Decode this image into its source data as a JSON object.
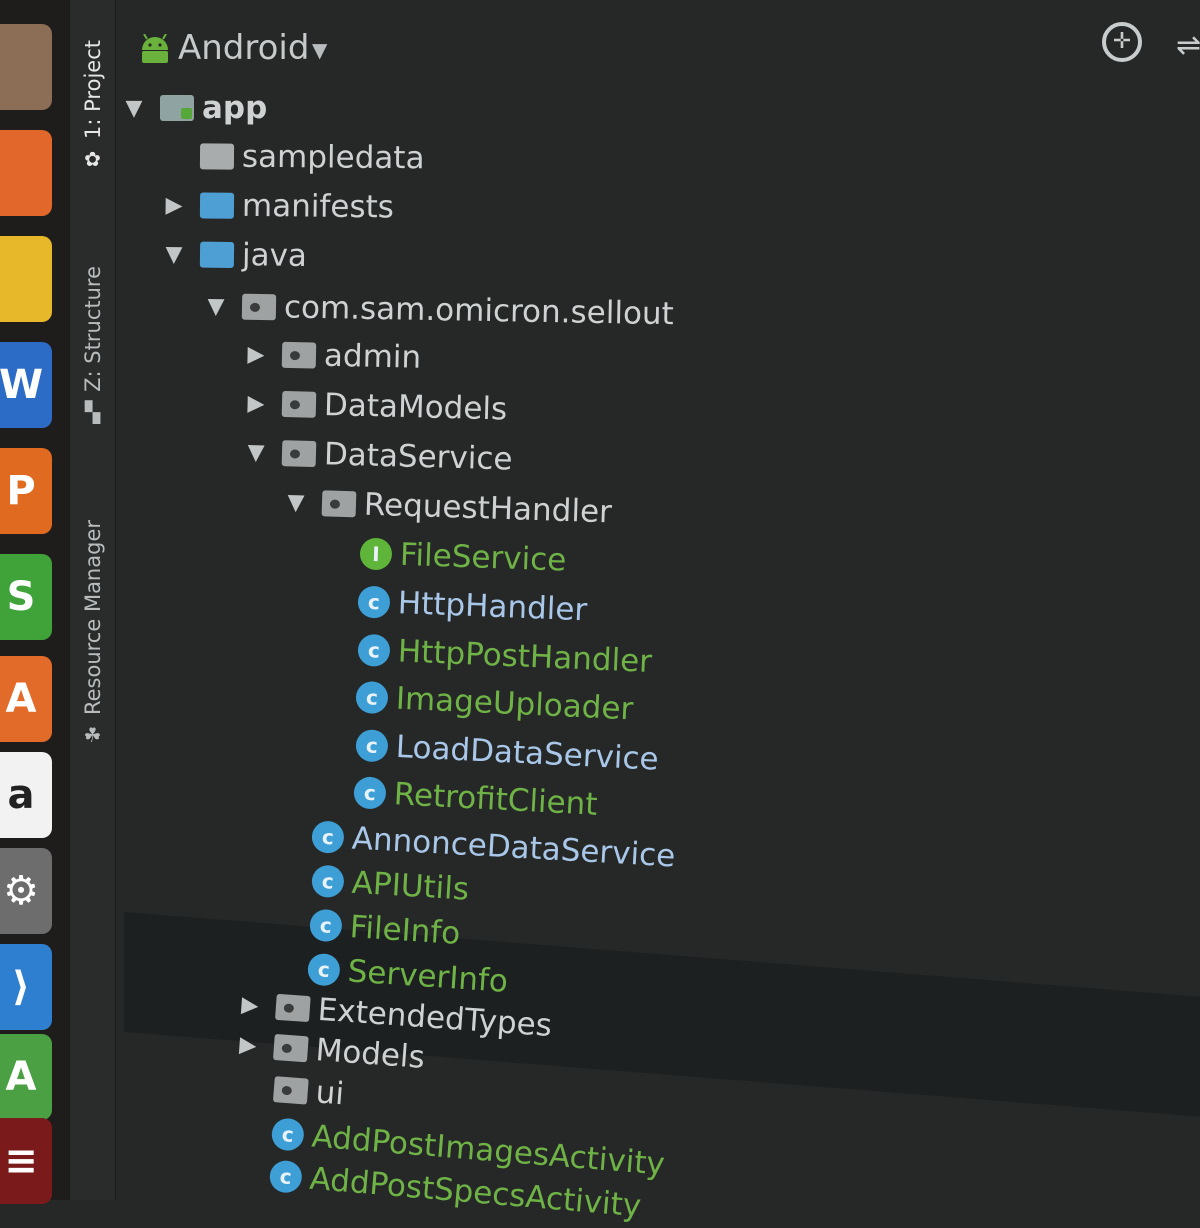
{
  "dock": {
    "icons": [
      {
        "name": "files-icon",
        "glyph": "",
        "color": "#8c6d55"
      },
      {
        "name": "firefox-icon",
        "glyph": "",
        "color": "#e2672b"
      },
      {
        "name": "chrome-icon",
        "glyph": "",
        "color": "#e6b82a"
      },
      {
        "name": "writer-icon",
        "glyph": "W",
        "color": "#2d6cc6"
      },
      {
        "name": "impress-icon",
        "glyph": "P",
        "color": "#e06a1f"
      },
      {
        "name": "calc-icon",
        "glyph": "S",
        "color": "#3fa33a"
      },
      {
        "name": "software-center-icon",
        "glyph": "A",
        "color": "#e36b2a"
      },
      {
        "name": "amazon-icon",
        "glyph": "a",
        "color": "#f2f2f2"
      },
      {
        "name": "system-settings-icon",
        "glyph": "⚙",
        "color": "#6d6d6d"
      },
      {
        "name": "vscode-icon",
        "glyph": "⟩",
        "color": "#2f7fd0"
      },
      {
        "name": "android-studio-icon",
        "glyph": "A",
        "color": "#4aa043"
      },
      {
        "name": "terminal-icon",
        "glyph": "≡",
        "color": "#7a1a1a"
      }
    ]
  },
  "tool_stripe": {
    "project": "1: Project",
    "structure": "Z: Structure",
    "resource_manager": "Resource Manager"
  },
  "panel": {
    "view_selector": "Android",
    "tree": [
      {
        "label": "app",
        "arrow": "down",
        "icon": "module",
        "color": "normal",
        "bold": true
      },
      {
        "label": "sampledata",
        "arrow": "none",
        "icon": "folder-grey",
        "color": "normal"
      },
      {
        "label": "manifests",
        "arrow": "right",
        "icon": "folder-blue",
        "color": "normal"
      },
      {
        "label": "java",
        "arrow": "down",
        "icon": "folder-blue",
        "color": "normal"
      },
      {
        "label": "com.sam.omicron.sellout",
        "arrow": "down",
        "icon": "package",
        "color": "normal"
      },
      {
        "label": "admin",
        "arrow": "right",
        "icon": "package",
        "color": "normal"
      },
      {
        "label": "DataModels",
        "arrow": "right",
        "icon": "package",
        "color": "normal"
      },
      {
        "label": "DataService",
        "arrow": "down",
        "icon": "package",
        "color": "normal"
      },
      {
        "label": "RequestHandler",
        "arrow": "down",
        "icon": "package",
        "color": "normal"
      },
      {
        "label": "FileService",
        "arrow": "none",
        "icon": "interface",
        "color": "green"
      },
      {
        "label": "HttpHandler",
        "arrow": "none",
        "icon": "class",
        "color": "blue"
      },
      {
        "label": "HttpPostHandler",
        "arrow": "none",
        "icon": "class",
        "color": "green"
      },
      {
        "label": "ImageUploader",
        "arrow": "none",
        "icon": "class",
        "color": "green"
      },
      {
        "label": "LoadDataService",
        "arrow": "none",
        "icon": "class",
        "color": "blue"
      },
      {
        "label": "RetrofitClient",
        "arrow": "none",
        "icon": "class",
        "color": "green"
      },
      {
        "label": "AnnonceDataService",
        "arrow": "none",
        "icon": "class",
        "color": "blue"
      },
      {
        "label": "APIUtils",
        "arrow": "none",
        "icon": "class",
        "color": "green"
      },
      {
        "label": "FileInfo",
        "arrow": "none",
        "icon": "class",
        "color": "green"
      },
      {
        "label": "ServerInfo",
        "arrow": "none",
        "icon": "class",
        "color": "green",
        "selected": true
      },
      {
        "label": "ExtendedTypes",
        "arrow": "right",
        "icon": "package",
        "color": "normal"
      },
      {
        "label": "Models",
        "arrow": "right",
        "icon": "package",
        "color": "normal"
      },
      {
        "label": "ui",
        "arrow": "none",
        "icon": "package",
        "color": "normal"
      },
      {
        "label": "AddPostImagesActivity",
        "arrow": "none",
        "icon": "class",
        "color": "green"
      },
      {
        "label": "AddPostSpecsActivity",
        "arrow": "none",
        "icon": "class",
        "color": "green"
      }
    ]
  }
}
